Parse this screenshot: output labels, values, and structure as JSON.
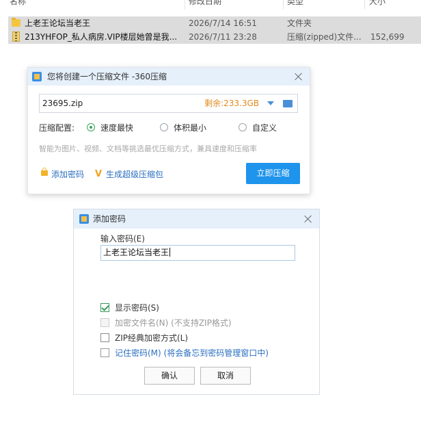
{
  "explorer": {
    "columns": {
      "name": "名称",
      "modified": "修改日期",
      "type": "类型",
      "size": "大小"
    },
    "rows": [
      {
        "name": "上老王论坛当老王",
        "date": "2026/7/14 16:51",
        "type": "文件夹",
        "size": "",
        "icon": "folder-icon"
      },
      {
        "name": "213YHFOP_私人病房.VIP楼层她曾是我...",
        "date": "2026/7/11 23:28",
        "type": "压缩(zipped)文件...",
        "size": "152,699",
        "icon": "zip-file-icon"
      }
    ]
  },
  "compress_dialog": {
    "title": "您将创建一个压缩文件 -360压缩",
    "filename": "23695.zip",
    "free_space": "剩余:233.3GB",
    "config_label": "压缩配置:",
    "options": [
      "速度最快",
      "体积最小",
      "自定义"
    ],
    "selected_option": "速度最快",
    "hint": "智能为图片、视频、文档等挑选最优压缩方式，兼具速度和压缩率",
    "add_password_link": "添加密码",
    "super_pack_link": "生成超级压缩包",
    "compress_button": "立即压缩",
    "colors": {
      "primary": "#1e94ec",
      "accent_orange": "#e08a1e",
      "radio_green": "#3aa55a"
    }
  },
  "password_dialog": {
    "title": "添加密码",
    "input_label": "输入密码(E)",
    "password_value": "上老王论坛当老王",
    "show_password": {
      "label": "显示密码(S)",
      "checked": true
    },
    "encrypt_filename": {
      "label": "加密文件名(N) (不支持ZIP格式)",
      "checked": false,
      "disabled": true
    },
    "zip_classic": {
      "label": "ZIP经典加密方式(L)",
      "checked": false
    },
    "remember_password": {
      "label": "记住密码(M) (将会备忘到密码管理窗口中)",
      "checked": false
    },
    "ok_button": "确认",
    "cancel_button": "取消"
  }
}
